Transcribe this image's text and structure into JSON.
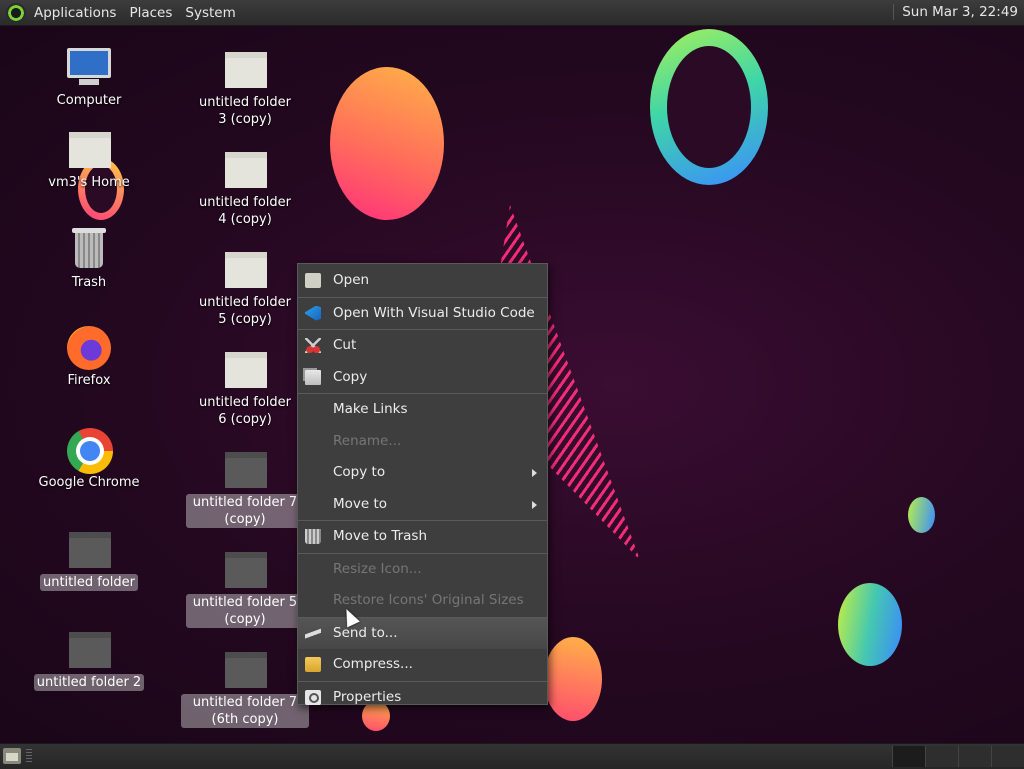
{
  "top_panel": {
    "menus": [
      "Applications",
      "Places",
      "System"
    ],
    "clock": "Sun Mar  3, 22:49"
  },
  "desktop_icons": {
    "computer": "Computer",
    "home": "vm3's Home",
    "trash": "Trash",
    "firefox": "Firefox",
    "chrome": "Google Chrome",
    "folder_a": "untitled folder",
    "folder_b": "untitled folder 2",
    "folder_c": "untitled folder 3 (copy)",
    "folder_d": "untitled folder 4 (copy)",
    "folder_e": "untitled folder 5 (copy)",
    "folder_f": "untitled folder 6 (copy)",
    "folder_g": "untitled folder 7 (copy)",
    "folder_h": "untitled folder 5 (copy)",
    "folder_i": "untitled folder 7 (6th copy)"
  },
  "context_menu": {
    "items": [
      {
        "label": "Open",
        "icon": "folder-open-icon",
        "enabled": true
      },
      {
        "label": "Open With Visual Studio Code",
        "icon": "vscode-icon",
        "enabled": true
      },
      {
        "label": "Cut",
        "icon": "scissors-icon",
        "enabled": true
      },
      {
        "label": "Copy",
        "icon": "copy-icon",
        "enabled": true
      },
      {
        "label": "Make Links",
        "enabled": true
      },
      {
        "label": "Rename...",
        "enabled": false
      },
      {
        "label": "Copy to",
        "enabled": true,
        "submenu": true
      },
      {
        "label": "Move to",
        "enabled": true,
        "submenu": true
      },
      {
        "label": "Move to Trash",
        "icon": "trash-icon",
        "enabled": true
      },
      {
        "label": "Resize Icon...",
        "enabled": false
      },
      {
        "label": "Restore Icons' Original Sizes",
        "enabled": false
      },
      {
        "label": "Send to...",
        "icon": "send-icon",
        "enabled": true,
        "hovered": true
      },
      {
        "label": "Compress...",
        "icon": "archive-icon",
        "enabled": true
      },
      {
        "label": "Properties",
        "icon": "properties-icon",
        "enabled": true
      }
    ]
  },
  "colors": {
    "panel": "#2b2b2b",
    "menu_bg": "#3e3e3e",
    "accent_pink": "#ff2d7a",
    "accent_green": "#7bd13a"
  }
}
